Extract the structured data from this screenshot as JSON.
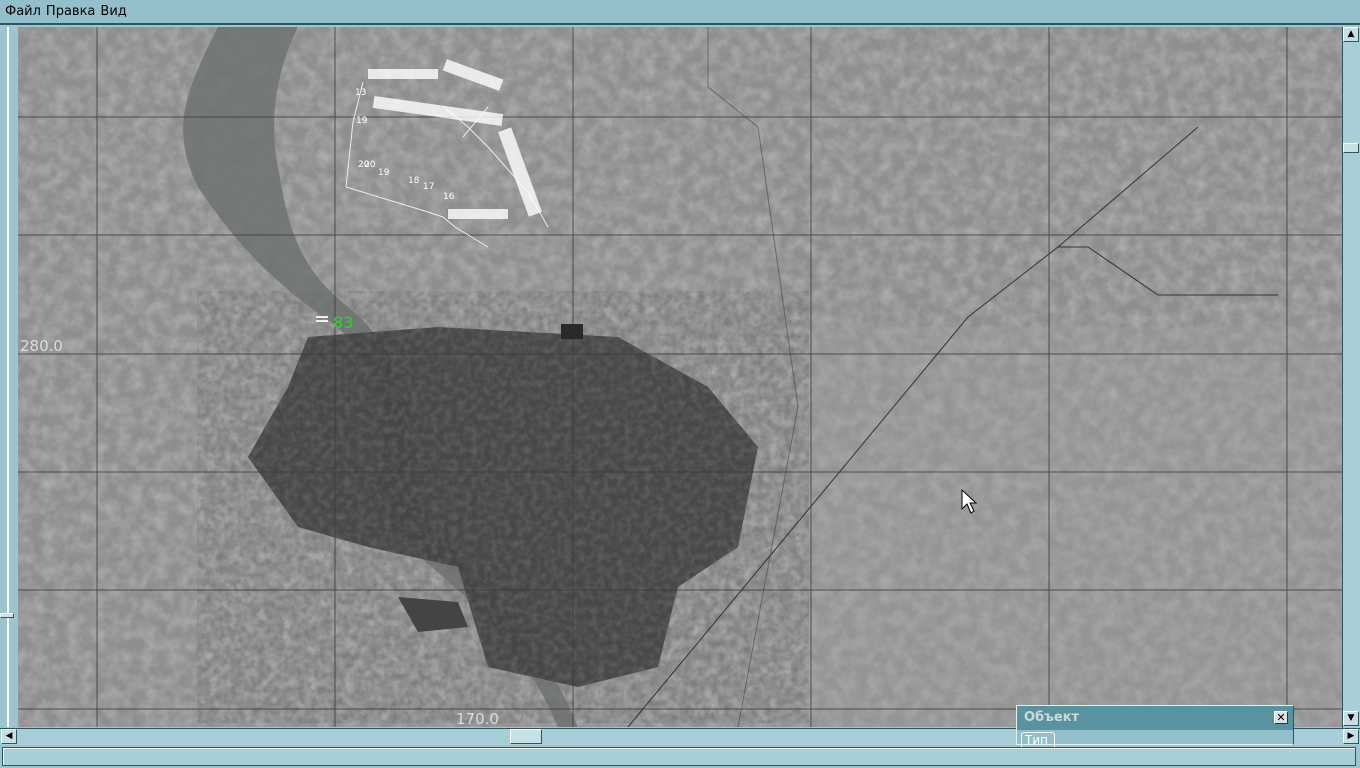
{
  "menu": {
    "items": [
      "Файл",
      "Правка",
      "Вид"
    ]
  },
  "map": {
    "coord_left": "280.0",
    "coord_bottom": "170.0",
    "unit_label": "83",
    "unit_color": "#22dd22"
  },
  "object_panel": {
    "title": "Объект",
    "close": "✕",
    "tab": "Тип"
  },
  "scroll": {
    "up": "▲",
    "down": "▼",
    "left": "◀",
    "right": "▶"
  }
}
